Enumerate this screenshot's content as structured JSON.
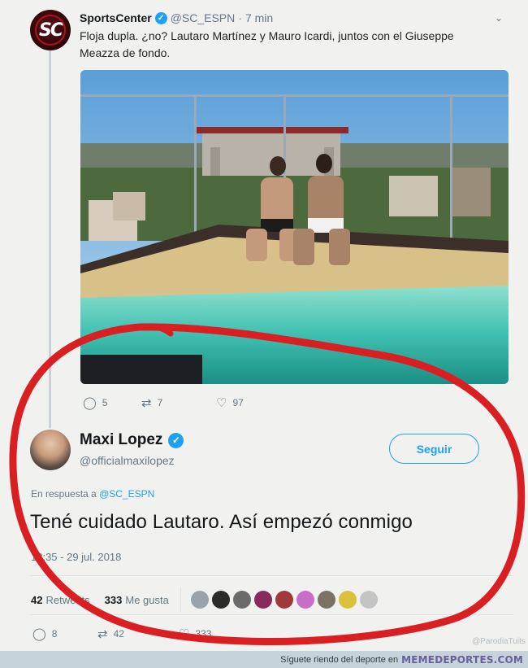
{
  "original_tweet": {
    "avatar_text": "SC",
    "name": "SportsCenter",
    "handle": "@SC_ESPN",
    "dot": "·",
    "time": "7 min",
    "text": "Floja dupla. ¿no? Lautaro Martínez y Mauro Icardi, juntos con el Giuseppe Meazza de fondo.",
    "actions": {
      "replies": "5",
      "retweets": "7",
      "likes": "97"
    }
  },
  "reply_tweet": {
    "name": "Maxi Lopez",
    "handle": "@officialmaxilopez",
    "follow_label": "Seguir",
    "reply_prefix": "En respuesta a",
    "reply_to": "@SC_ESPN",
    "text": "Tené cuidado Lautaro. Así empezó conmigo",
    "timestamp": "12:35 - 29 jul. 2018",
    "stats": {
      "retweets_count": "42",
      "retweets_label": "Retweets",
      "likes_count": "333",
      "likes_label": "Me gusta"
    },
    "actions": {
      "replies": "8",
      "retweets": "42",
      "likes": "333"
    }
  },
  "icons": {
    "reply": "speech-bubble-icon",
    "retweet": "retweet-icon",
    "like": "heart-icon",
    "verified": "verified-badge-icon",
    "caret": "chevron-down-icon"
  },
  "colors": {
    "twitter_blue": "#1da1f2",
    "annotation_red": "#d91f22",
    "secondary_text": "#657786"
  },
  "watermark": "@ParodiaTuits",
  "footer": {
    "text": "Síguete riendo del deporte en",
    "brand": "MEMEDEPORTES.COM"
  }
}
